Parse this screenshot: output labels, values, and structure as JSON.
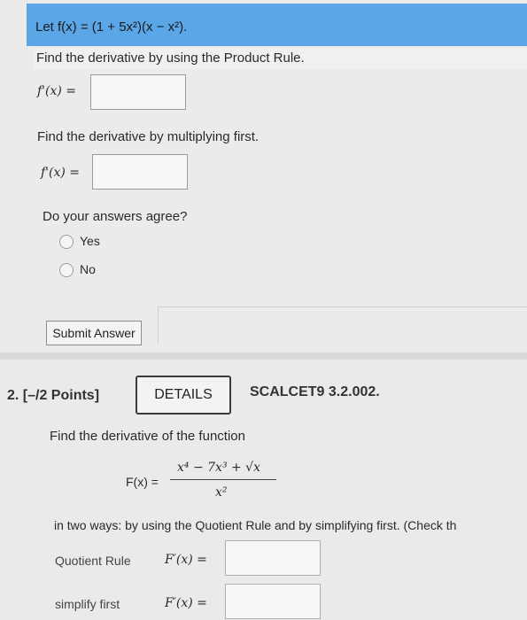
{
  "q1": {
    "prompt": "Let f(x) = (1 + 5x²)(x − x²).",
    "product_rule_instruction": "Find the derivative by using the Product Rule.",
    "multiply_first_instruction": "Find the derivative by multiplying first.",
    "derivative_label": "f'(x) =",
    "agree_question": "Do your answers agree?",
    "options": [
      "Yes",
      "No"
    ],
    "submit_label": "Submit Answer"
  },
  "q2": {
    "number": "2.  [–/2 Points]",
    "details_label": "DETAILS",
    "course_code": "SCALCET9 3.2.002.",
    "instruction": "Find the derivative of the function",
    "function_lhs": "F(x) =",
    "numerator": "x⁴ − 7x³ + √x",
    "denominator": "x²",
    "ways_text": "in two ways: by using the Quotient Rule and by simplifying first. (Check th",
    "quotient_rule_label": "Quotient Rule",
    "simplify_label": "simplify first",
    "Fprime_label": "F′(x) ="
  },
  "colors": {
    "highlight": "#5aa6e6"
  }
}
